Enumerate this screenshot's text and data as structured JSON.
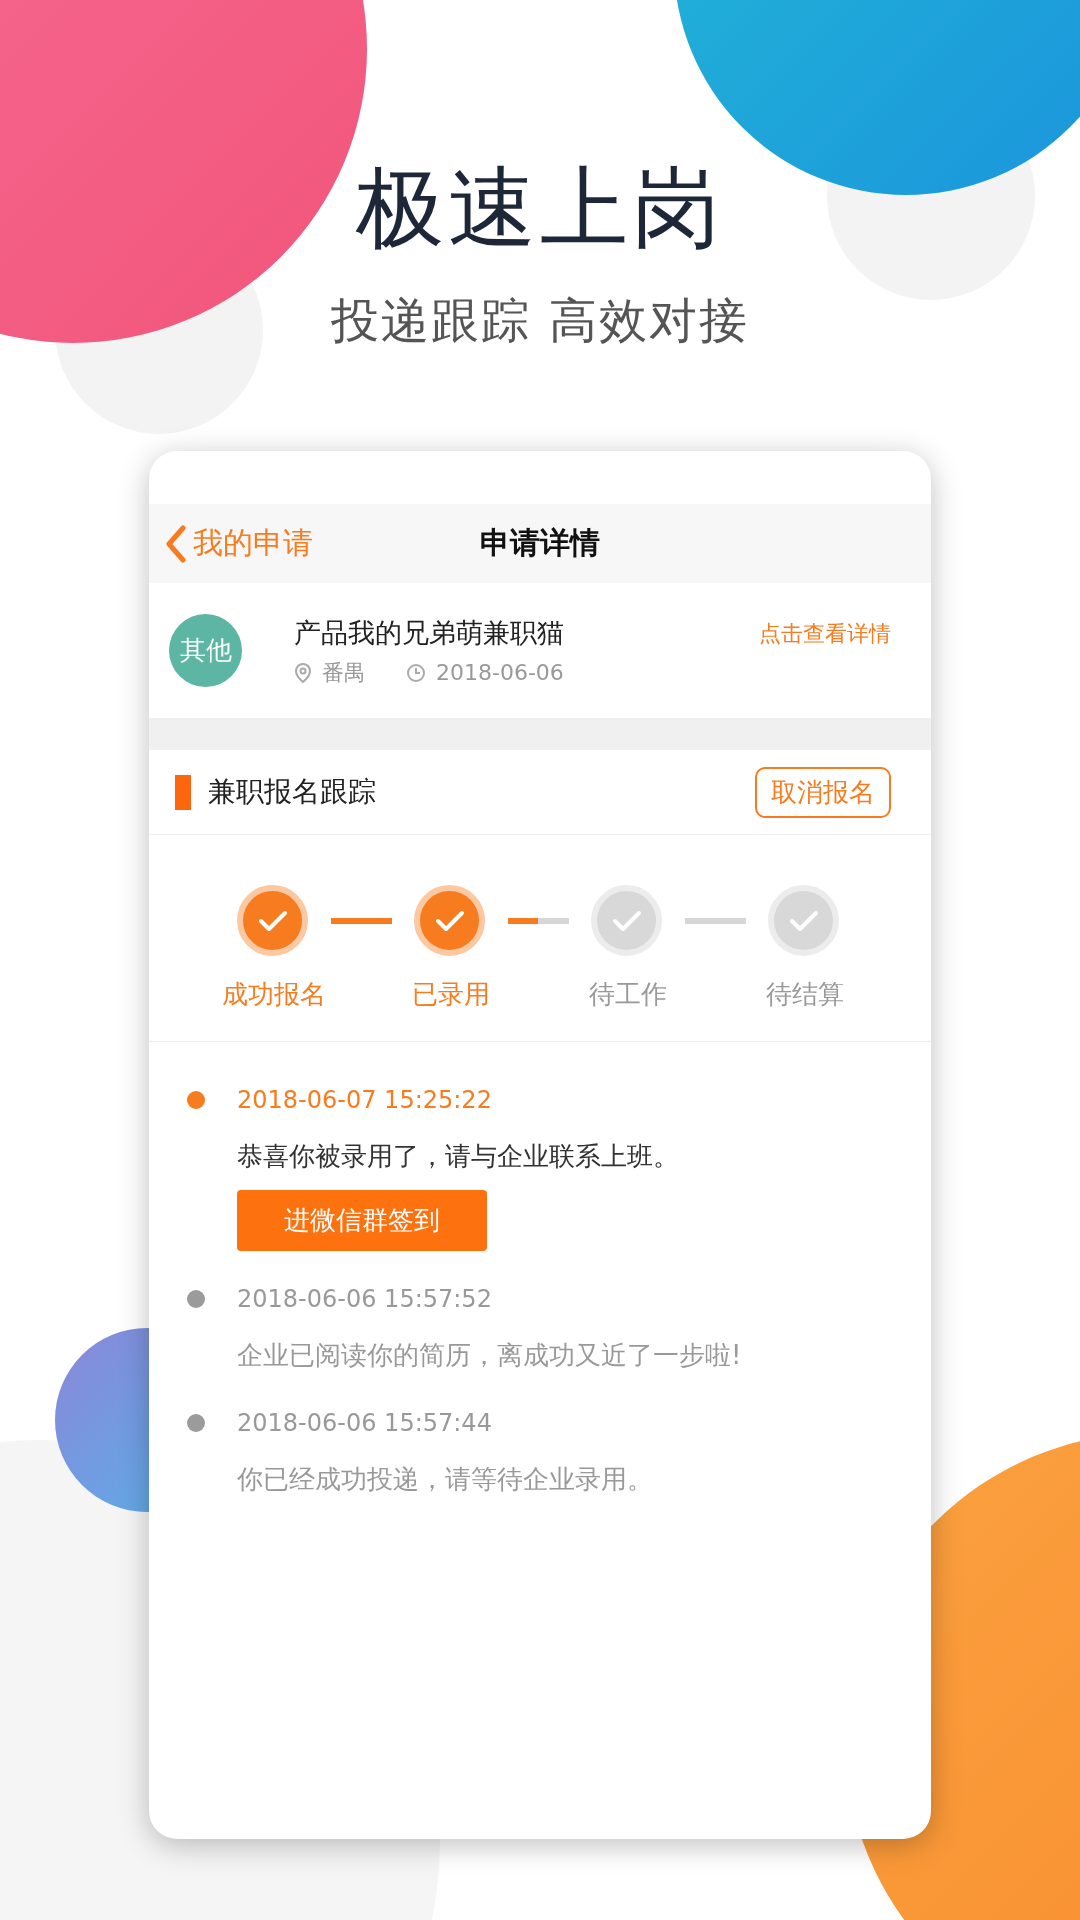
{
  "headline": {
    "title": "极速上岗",
    "subtitle": "投递跟踪 高效对接"
  },
  "nav": {
    "back_label": "我的申请",
    "title": "申请详情"
  },
  "job": {
    "category": "其他",
    "title": "产品我的兄弟萌兼职猫",
    "location": "番禺",
    "date": "2018-06-06",
    "link": "点击查看详情"
  },
  "tracking": {
    "title": "兼职报名跟踪",
    "cancel_button": "取消报名",
    "steps": [
      {
        "label": "成功报名",
        "done": true
      },
      {
        "label": "已录用",
        "done": true
      },
      {
        "label": "待工作",
        "done": false
      },
      {
        "label": "待结算",
        "done": false
      }
    ],
    "connectors": [
      {
        "level": 1
      },
      {
        "level": 0.5
      },
      {
        "level": 0
      }
    ]
  },
  "timeline": [
    {
      "time": "2018-06-07 15:25:22",
      "message": "恭喜你被录用了，请与企业联系上班。",
      "active": true,
      "button": "进微信群签到"
    },
    {
      "time": "2018-06-06 15:57:52",
      "message": "企业已阅读你的简历，离成功又近了一步啦!",
      "active": false
    },
    {
      "time": "2018-06-06 15:57:44",
      "message": "你已经成功投递，请等待企业录用。",
      "active": false
    }
  ]
}
